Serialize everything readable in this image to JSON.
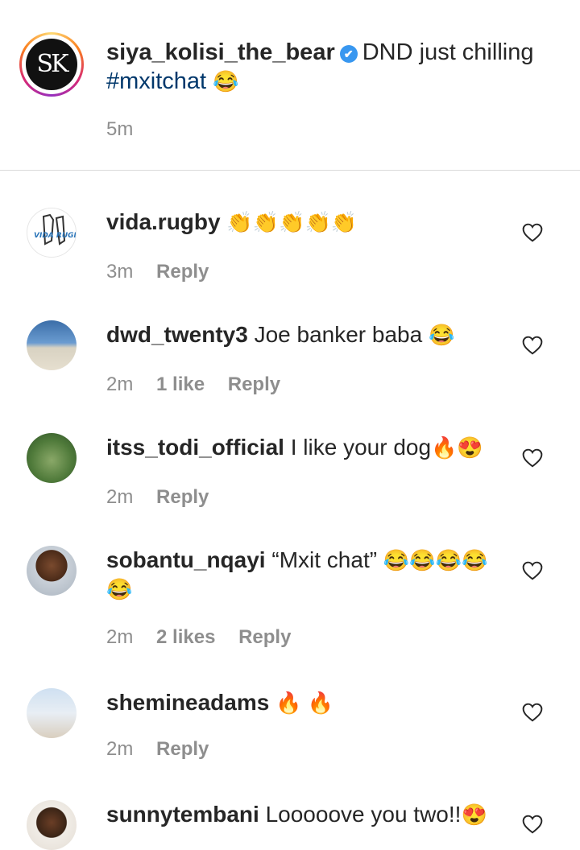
{
  "caption": {
    "avatar_initials": "SK",
    "username": "siya_kolisi_the_bear",
    "verified_icon": "✔",
    "text": "DND just chilling",
    "hashtag": "#mxitchat",
    "emoji": "😂",
    "time": "5m"
  },
  "comments": [
    {
      "username": "vida.rugby",
      "text": "",
      "emoji": "👏👏👏👏👏",
      "time": "3m",
      "likes": "",
      "reply": "Reply",
      "avatar_label": "VIDA RUGBY"
    },
    {
      "username": "dwd_twenty3",
      "text": "Joe banker baba",
      "emoji": "😂",
      "time": "2m",
      "likes": "1 like",
      "reply": "Reply"
    },
    {
      "username": "itss_todi_official",
      "text": "I like your dog",
      "emoji": "🔥😍",
      "time": "2m",
      "likes": "",
      "reply": "Reply"
    },
    {
      "username": "sobantu_nqayi",
      "text": "“Mxit chat”",
      "emoji": "😂😂😂😂 😂",
      "time": "2m",
      "likes": "2 likes",
      "reply": "Reply"
    },
    {
      "username": "shemineadams",
      "text": "",
      "emoji": "🔥 🔥",
      "time": "2m",
      "likes": "",
      "reply": "Reply"
    },
    {
      "username": "sunnytembani",
      "text": "Looooove you two!!",
      "emoji": "😍",
      "time": "",
      "likes": "",
      "reply": ""
    }
  ],
  "icons": {
    "heart": "heart-outline-icon"
  },
  "colors": {
    "username": "#262626",
    "meta": "#8e8e8e",
    "hashtag": "#00376b",
    "verified": "#3897f0"
  }
}
